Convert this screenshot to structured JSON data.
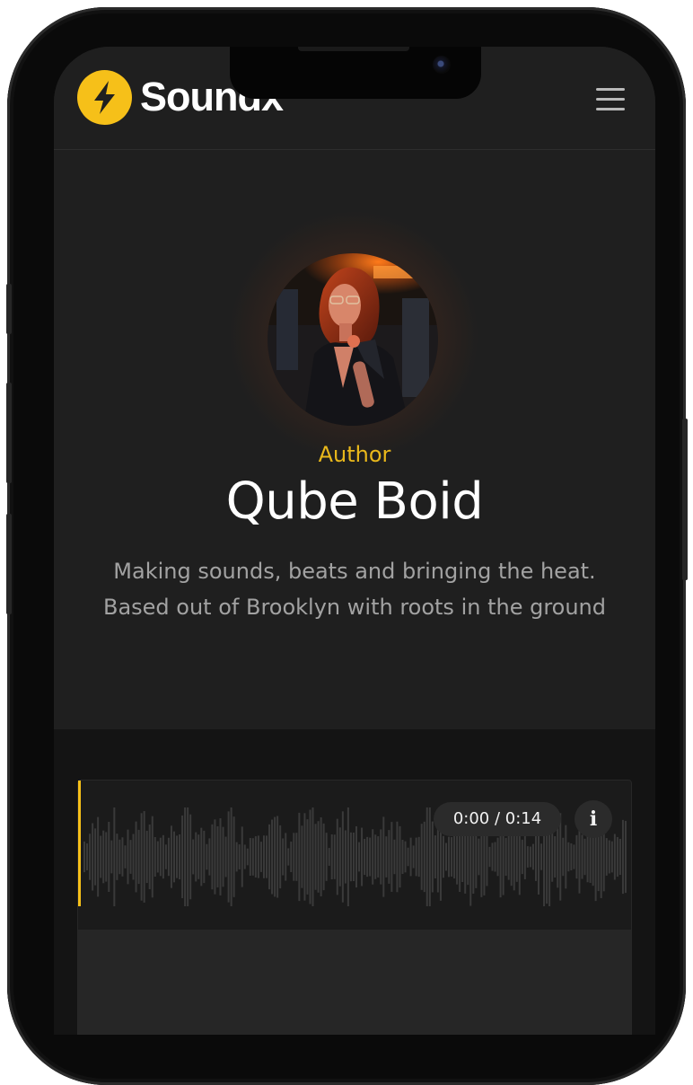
{
  "app": {
    "brand": "Soundx",
    "accent_color": "#f6c019"
  },
  "header": {
    "logo_icon": "lightning-bolt-icon",
    "menu_icon": "hamburger-menu-icon"
  },
  "profile": {
    "role": "Author",
    "name": "Qube Boid",
    "bio_line1": "Making sounds, beats and bringing the heat.",
    "bio_line2": "Based out of Brooklyn with roots in the ground"
  },
  "player": {
    "time": "0:00 / 0:14",
    "progress": 0,
    "info_label": "i"
  }
}
